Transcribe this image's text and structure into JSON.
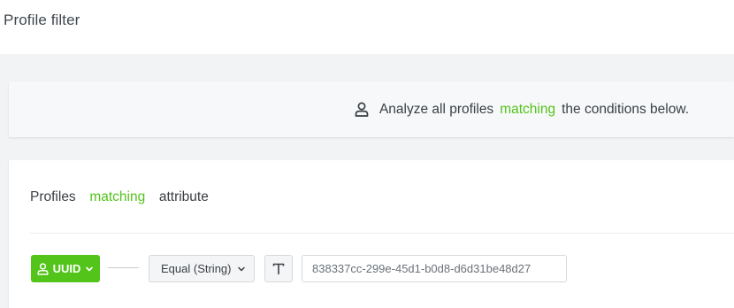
{
  "page": {
    "title": "Profile filter"
  },
  "banner": {
    "icon": "person-icon",
    "text_before": "Analyze all profiles",
    "text_accent": "matching",
    "text_after": "the conditions below."
  },
  "card": {
    "title_before": "Profiles",
    "title_accent": "matching",
    "title_after": "attribute"
  },
  "condition": {
    "attribute_label": "UUID",
    "attribute_icon": "person-icon",
    "operator_label": "Equal (String)",
    "type_icon": "text-type-icon",
    "value": "838337cc-299e-45d1-b0d8-d6d31be48d27"
  },
  "colors": {
    "accent": "#52c41a",
    "text": "#3a3f44",
    "background": "#f2f3f4"
  }
}
